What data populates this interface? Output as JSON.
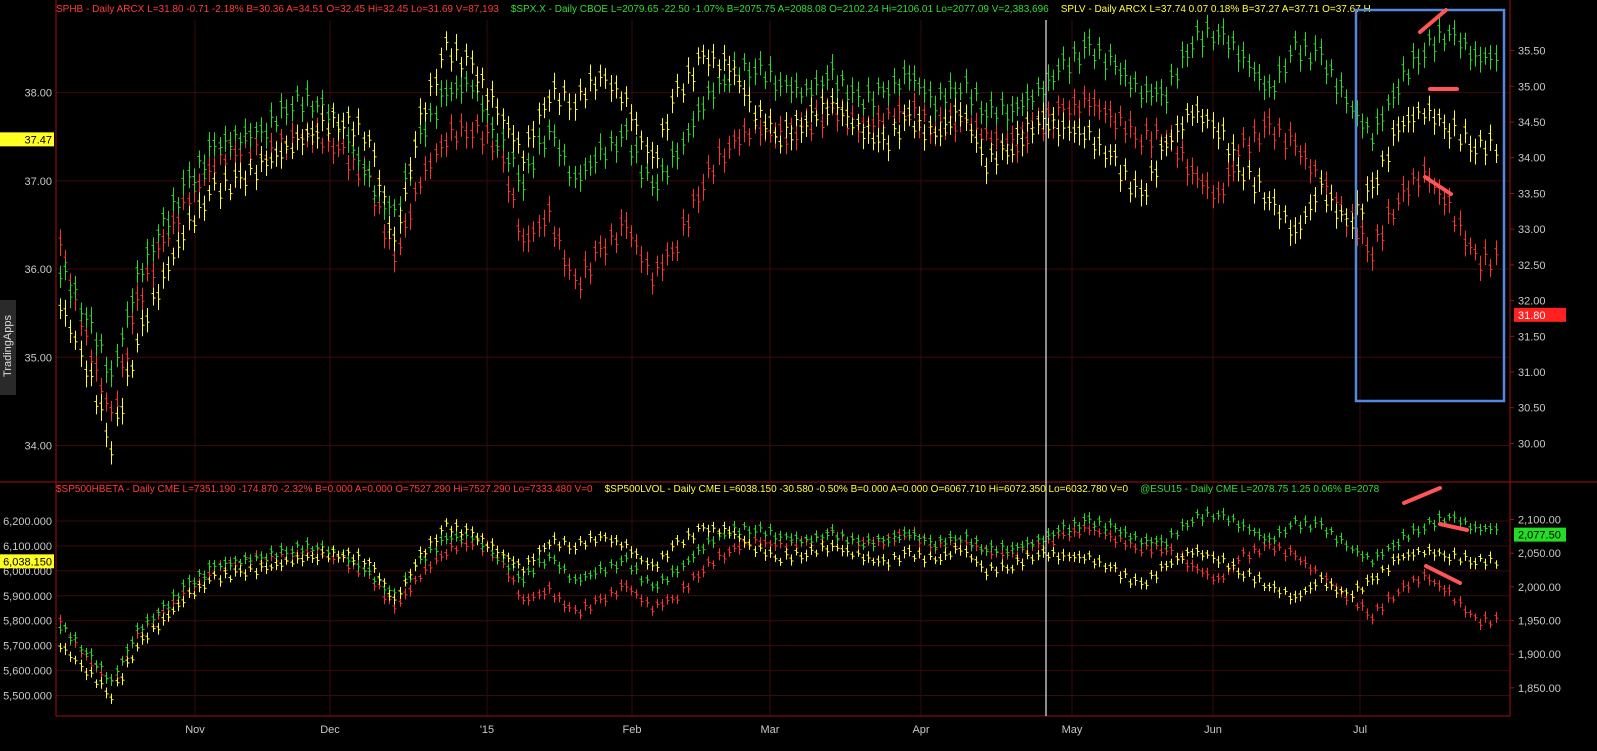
{
  "sidebar": {
    "label": "TradingApps"
  },
  "top_header": [
    {
      "text": "SPHB - Daily  ARCX  L=31.80  -0.71  -2.18%  B=30.36  A=34.51  O=32.45  Hi=32.45  Lo=31.69  V=87,193",
      "color": "#ff3b3b"
    },
    {
      "text": "$SPX.X - Daily  CBOE  L=2079.65  -22.50  -1.07%  B=2075.75  A=2088.08  O=2102.24  Hi=2106.01  Lo=2077.09  V=2,383,696",
      "color": "#33dd33"
    },
    {
      "text": "SPLV - Daily  ARCX  L=37.74  0.07  0.18%  B=37.27  A=37.71  O=37.67  H",
      "color": "#ffff33"
    }
  ],
  "bottom_header": [
    {
      "text": "$SP500HBETA - Daily  CME  L=7351.190  -174.870  -2.32%  B=0.000  A=0.000  O=7527.290  Hi=7527.290  Lo=7333.480  V=0",
      "color": "#ff3b3b"
    },
    {
      "text": "$SP500LVOL - Daily  CME  L=6038.150  -30.580  -0.50%  B=0.000  A=0.000  O=6067.710  Hi=6072.350  Lo=6032.780  V=0",
      "color": "#ffff33"
    },
    {
      "text": "@ESU15 - Daily  CME  L=2078.75  1.25  0.06%  B=2078",
      "color": "#33dd33"
    }
  ],
  "colors": {
    "red": "#ff3030",
    "green": "#22dd22",
    "yellow": "#ffff22",
    "grid": "#3a0a0a",
    "annotation": "#ff5555",
    "box": "#5588dd"
  },
  "chart_data": [
    {
      "type": "line",
      "panel": "top",
      "x_ticks": [
        "Nov",
        "Dec",
        "'15",
        "Feb",
        "Mar",
        "Apr",
        "May",
        "Jun",
        "Jul"
      ],
      "left_ticks": [
        "38.00",
        "37.00",
        "36.00",
        "35.00",
        "34.00"
      ],
      "left_ylim": [
        33.7,
        38.8
      ],
      "right_ticks": [
        "35.50",
        "35.00",
        "34.50",
        "34.00",
        "33.50",
        "33.00",
        "32.50",
        "32.00",
        "31.50",
        "31.00",
        "30.50",
        "30.00"
      ],
      "right_ylim": [
        29.6,
        35.9
      ],
      "left_marker": {
        "value": 37.47,
        "label": "37.47"
      },
      "right_marker": {
        "value": 31.8,
        "label": "31.80"
      },
      "series": [
        {
          "name": "SPHB",
          "color": "red",
          "values": [
            36.3,
            35.2,
            34.3,
            35.6,
            36.3,
            36.8,
            37.2,
            37.4,
            37.3,
            37.5,
            37.5,
            37.3,
            37.0,
            36.1,
            37.0,
            37.5,
            37.6,
            37.4,
            36.3,
            36.6,
            35.8,
            36.2,
            36.5,
            35.9,
            36.3,
            37.0,
            37.4,
            37.6,
            37.5,
            37.6,
            37.8,
            37.6,
            37.7,
            37.8,
            37.6,
            37.7,
            37.5,
            37.4,
            37.6,
            37.8,
            37.9,
            37.7,
            37.5,
            37.5,
            37.1,
            36.8,
            37.4,
            37.6,
            37.4,
            37.0,
            36.6,
            36.2,
            36.8,
            37.1,
            36.7,
            36.1
          ]
        },
        {
          "name": "$SPX.X",
          "color": "green",
          "values": [
            36.0,
            35.5,
            34.8,
            35.9,
            36.5,
            37.0,
            37.4,
            37.5,
            37.6,
            37.9,
            37.9,
            37.6,
            37.0,
            36.6,
            37.5,
            38.0,
            38.1,
            37.5,
            37.0,
            37.6,
            37.0,
            37.3,
            37.5,
            36.9,
            37.3,
            37.9,
            38.2,
            38.3,
            38.1,
            38.0,
            38.2,
            37.9,
            38.0,
            38.2,
            37.9,
            38.1,
            37.8,
            37.8,
            38.0,
            38.3,
            38.5,
            38.3,
            38.0,
            38.0,
            38.6,
            38.7,
            38.4,
            38.0,
            38.5,
            38.4,
            37.9,
            37.5,
            38.1,
            38.5,
            38.7,
            38.4
          ]
        },
        {
          "name": "SPLV",
          "color": "yellow",
          "values": [
            35.6,
            34.9,
            34.0,
            35.2,
            35.9,
            36.5,
            36.9,
            37.0,
            37.2,
            37.4,
            37.6,
            37.7,
            37.5,
            36.3,
            37.7,
            38.5,
            38.3,
            37.8,
            37.3,
            38.0,
            37.9,
            38.2,
            37.9,
            37.2,
            38.0,
            38.4,
            38.3,
            37.8,
            37.5,
            37.7,
            37.9,
            37.6,
            37.4,
            37.7,
            37.5,
            37.8,
            37.2,
            37.4,
            37.7,
            37.6,
            37.5,
            37.2,
            36.8,
            37.4,
            37.8,
            37.6,
            37.1,
            36.8,
            36.4,
            36.9,
            36.5,
            36.9,
            37.6,
            37.8,
            37.6,
            37.4
          ]
        }
      ],
      "annotations": [
        "box around Jul",
        "up arrow green",
        "flat line yellow",
        "down arrow red"
      ]
    },
    {
      "type": "line",
      "panel": "bottom",
      "x_ticks": [
        "Nov",
        "Dec",
        "'15",
        "Feb",
        "Mar",
        "Apr",
        "May",
        "Jun",
        "Jul"
      ],
      "left_ticks": [
        "6,200.000",
        "6,100.000",
        "6,000.000",
        "5,900.000",
        "5,800.000",
        "5,700.000",
        "5,600.000",
        "5,500.000"
      ],
      "left_ylim": [
        5450,
        6260
      ],
      "right_ticks": [
        "2,100.00",
        "2,050.00",
        "2,000.00",
        "1,950.00",
        "1,900.00",
        "1,850.00"
      ],
      "right_ylim": [
        1820,
        2120
      ],
      "left_marker": {
        "value": 6038.15,
        "label": "6,038.150"
      },
      "right_marker": {
        "value": 2077.5,
        "label": "2,077.50"
      },
      "series": [
        {
          "name": "$SP500HBETA",
          "color": "red",
          "values": [
            5800,
            5650,
            5550,
            5740,
            5830,
            5920,
            6000,
            6040,
            6050,
            6060,
            6080,
            6040,
            5980,
            5850,
            5980,
            6080,
            6120,
            6060,
            5880,
            5920,
            5830,
            5880,
            5940,
            5850,
            5900,
            6010,
            6080,
            6120,
            6100,
            6110,
            6150,
            6110,
            6120,
            6150,
            6100,
            6120,
            6080,
            6060,
            6100,
            6140,
            6170,
            6130,
            6090,
            6090,
            6020,
            5960,
            6060,
            6100,
            6060,
            5980,
            5900,
            5820,
            5920,
            5980,
            5910,
            5800
          ]
        },
        {
          "name": "@ESU15",
          "color": "green",
          "values": [
            5780,
            5680,
            5560,
            5760,
            5850,
            5950,
            6020,
            6040,
            6060,
            6090,
            6100,
            6060,
            5990,
            5900,
            6040,
            6130,
            6140,
            6060,
            5970,
            6060,
            5960,
            6000,
            6040,
            5930,
            6000,
            6100,
            6160,
            6170,
            6140,
            6120,
            6150,
            6110,
            6120,
            6150,
            6110,
            6140,
            6090,
            6090,
            6120,
            6170,
            6200,
            6170,
            6120,
            6120,
            6210,
            6230,
            6180,
            6120,
            6190,
            6180,
            6100,
            6040,
            6120,
            6180,
            6220,
            6170
          ]
        },
        {
          "name": "$SP500LVOL",
          "color": "yellow",
          "values": [
            5700,
            5600,
            5500,
            5700,
            5800,
            5900,
            5970,
            5990,
            6010,
            6040,
            6060,
            6070,
            6040,
            5880,
            6060,
            6180,
            6150,
            6080,
            6010,
            6120,
            6100,
            6140,
            6100,
            6010,
            6110,
            6170,
            6160,
            6090,
            6050,
            6070,
            6100,
            6060,
            6030,
            6070,
            6040,
            6090,
            6000,
            6020,
            6070,
            6060,
            6050,
            6000,
            5940,
            6020,
            6080,
            6050,
            5990,
            5940,
            5890,
            5960,
            5900,
            5960,
            6050,
            6080,
            6060,
            6040
          ]
        }
      ]
    }
  ]
}
